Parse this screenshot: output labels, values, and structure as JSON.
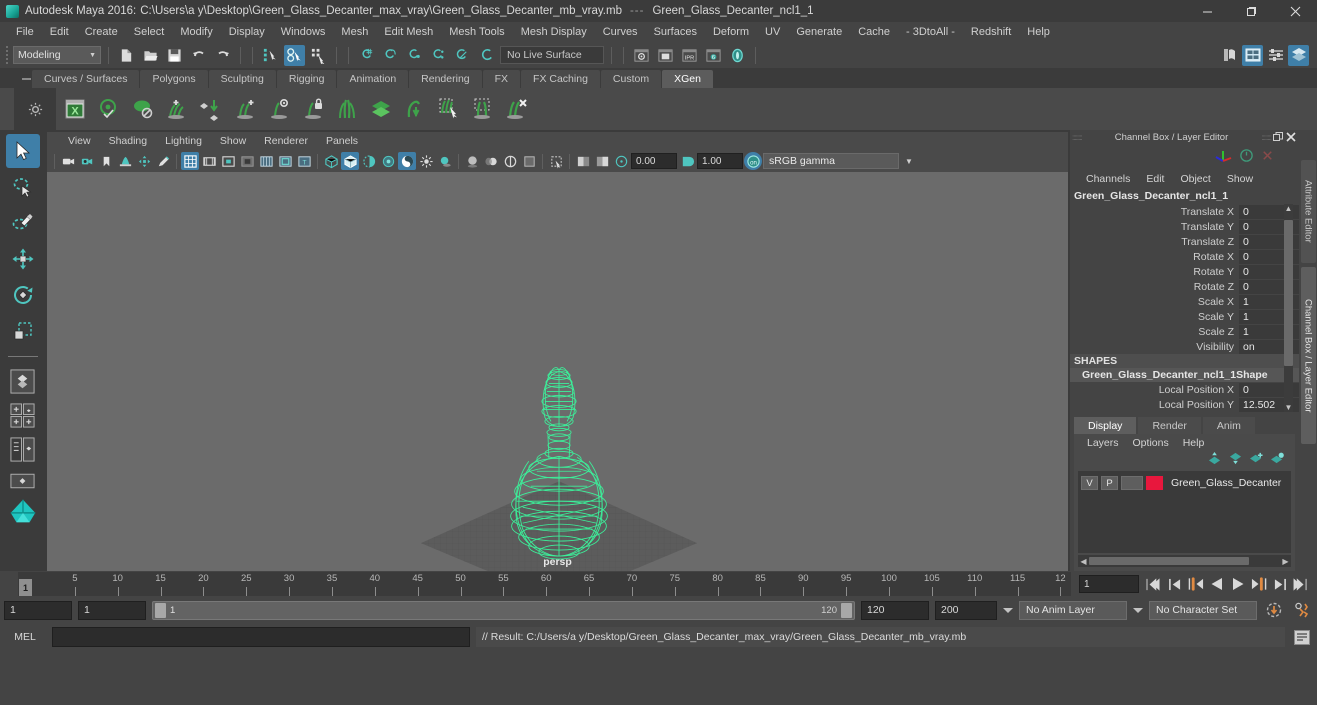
{
  "window": {
    "app_title": "Autodesk Maya 2016:",
    "file_path": "C:\\Users\\a y\\Desktop\\Green_Glass_Decanter_max_vray\\Green_Glass_Decanter_mb_vray.mb",
    "separator": "---",
    "selected_object": "Green_Glass_Decanter_ncl1_1",
    "minimize": "—",
    "maximize": "❐",
    "close": "✕"
  },
  "menubar": {
    "items": [
      "File",
      "Edit",
      "Create",
      "Select",
      "Modify",
      "Display",
      "Windows",
      "Mesh",
      "Edit Mesh",
      "Mesh Tools",
      "Mesh Display",
      "Curves",
      "Surfaces",
      "Deform",
      "UV",
      "Generate",
      "Cache",
      "- 3DtoAll -",
      "Redshift",
      "Help"
    ]
  },
  "statusbar": {
    "menuset": "Modeling",
    "live_surface": "No Live Surface",
    "icons": [
      "new-scene-icon",
      "open-scene-icon",
      "save-scene-icon",
      "undo-icon",
      "redo-icon",
      "select-by-hierarchy-icon",
      "select-by-object-icon",
      "select-by-component-icon",
      "snap-to-grid-icon",
      "snap-to-curve-icon",
      "snap-to-point-icon",
      "snap-to-projected-center-icon",
      "snap-to-view-plane-icon",
      "make-live-icon",
      "render-view-icon",
      "render-region-icon",
      "ipr-render-icon",
      "render-settings-icon",
      "hypershade-icon",
      "show-hide-sidebar-icon",
      "attribute-editor-toggle-icon",
      "tool-settings-toggle-icon",
      "channel-box-toggle-icon"
    ]
  },
  "shelf": {
    "tabs": [
      "Curves / Surfaces",
      "Polygons",
      "Sculpting",
      "Rigging",
      "Animation",
      "Rendering",
      "FX",
      "FX Caching",
      "Custom",
      "XGen"
    ],
    "active_tab": "XGen",
    "icons": [
      "xgen-editor-icon",
      "xgen-preview-icon",
      "xgen-disable-preview-icon",
      "xgen-add-guides-icon",
      "xgen-place-guide-icon",
      "xgen-add-density-icon",
      "xgen-region-mask-icon",
      "xgen-lock-icon",
      "xgen-part-icon",
      "xgen-layers-icon",
      "xgen-comb-icon",
      "xgen-select-guides-icon",
      "xgen-clump-icon",
      "xgen-delete-guides-icon"
    ]
  },
  "toolbox": {
    "tools": [
      "select-tool",
      "lasso-select-tool",
      "paint-select-tool",
      "move-tool",
      "rotate-tool",
      "scale-tool"
    ],
    "active_tool": "select-tool",
    "layouts": [
      "single-perspective-layout-icon",
      "four-view-layout-icon",
      "outliner-persp-layout-icon",
      "persp-graph-layout-icon",
      "hypershade-persp-layout-icon"
    ]
  },
  "viewport": {
    "menus": [
      "View",
      "Shading",
      "Lighting",
      "Show",
      "Renderer",
      "Panels"
    ],
    "camera_label": "persp",
    "exposure": "0.00",
    "gamma": "1.00",
    "color_profile": "sRGB gamma",
    "toolbar_icons": [
      "select-camera-icon",
      "camera-attributes-icon",
      "bookmark-icon",
      "image-plane-icon",
      "two-d-pan-zoom-icon",
      "grease-pencil-icon",
      "grid-toggle-icon",
      "film-gate-icon",
      "resolution-gate-icon",
      "gate-mask-icon",
      "field-chart-icon",
      "safe-action-icon",
      "safe-title-icon",
      "wireframe-icon",
      "smooth-shade-all-icon",
      "shaded-wireframe-icon",
      "use-default-material-icon",
      "textured-icon",
      "use-all-lights-icon",
      "shadows-icon",
      "screen-space-ao-icon",
      "motion-blur-icon",
      "multisample-icon",
      "depth-of-field-icon",
      "isolate-select-icon",
      "xray-icon",
      "xray-joints-icon",
      "xray-active-components-icon",
      "exposure-icon",
      "gamma-icon",
      "color-management-icon"
    ],
    "model": {
      "name": "Green_Glass_Decanter_ncl1_1",
      "wireframe_color": "#3cf09a",
      "background_color": "#6b6b6b"
    },
    "axis_gizmo": {
      "x": "x",
      "y": "y",
      "z": "z"
    }
  },
  "channel_box": {
    "panel_title": "Channel Box / Layer Editor",
    "menus": [
      "Channels",
      "Edit",
      "Object",
      "Show"
    ],
    "object_name": "Green_Glass_Decanter_ncl1_1",
    "transform_attrs": [
      {
        "label": "Translate X",
        "value": "0"
      },
      {
        "label": "Translate Y",
        "value": "0"
      },
      {
        "label": "Translate Z",
        "value": "0"
      },
      {
        "label": "Rotate X",
        "value": "0"
      },
      {
        "label": "Rotate Y",
        "value": "0"
      },
      {
        "label": "Rotate Z",
        "value": "0"
      },
      {
        "label": "Scale X",
        "value": "1"
      },
      {
        "label": "Scale Y",
        "value": "1"
      },
      {
        "label": "Scale Z",
        "value": "1"
      },
      {
        "label": "Visibility",
        "value": "on"
      }
    ],
    "shapes_header": "SHAPES",
    "shape_name": "Green_Glass_Decanter_ncl1_1Shape",
    "shape_attrs": [
      {
        "label": "Local Position X",
        "value": "0"
      },
      {
        "label": "Local Position Y",
        "value": "12.502"
      }
    ]
  },
  "layer_editor": {
    "tabs": [
      "Display",
      "Render",
      "Anim"
    ],
    "active_tab": "Display",
    "menus": [
      "Layers",
      "Options",
      "Help"
    ],
    "toolbar_icons": [
      "move-layer-up-icon",
      "move-layer-down-icon",
      "new-layer-icon",
      "new-layer-from-selected-icon"
    ],
    "layers": [
      {
        "visibility": "V",
        "playback": "P",
        "color": "#e8173d",
        "name": "Green_Glass_Decanter"
      }
    ]
  },
  "right_tabs": {
    "items": [
      "Attribute Editor",
      "Channel Box / Layer Editor"
    ],
    "active": "Channel Box / Layer Editor"
  },
  "timeline": {
    "tick_labels": [
      "5",
      "10",
      "15",
      "20",
      "25",
      "30",
      "35",
      "40",
      "45",
      "50",
      "55",
      "60",
      "65",
      "70",
      "75",
      "80",
      "85",
      "90",
      "95",
      "100",
      "105",
      "110",
      "115",
      "12"
    ],
    "current_frame": "1",
    "frame_field": "1",
    "playback_buttons": [
      "go-to-start-icon",
      "step-back-keyframe-icon",
      "step-back-frame-icon",
      "play-backwards-icon",
      "play-forwards-icon",
      "step-forward-frame-icon",
      "step-forward-keyframe-icon",
      "go-to-end-icon"
    ]
  },
  "range": {
    "anim_start": "1",
    "range_start": "1",
    "slider_min": "1",
    "slider_max": "120",
    "range_end": "120",
    "anim_end": "200",
    "anim_layer": "No Anim Layer",
    "character_set": "No Character Set",
    "auto_keyframe_icon": "auto-keyframe-icon",
    "animation_prefs_icon": "animation-preferences-icon"
  },
  "command_line": {
    "language": "MEL",
    "input_value": "",
    "result": "// Result: C:/Users/a y/Desktop/Green_Glass_Decanter_max_vray/Green_Glass_Decanter_mb_vray.mb",
    "script_editor_icon": "script-editor-icon"
  }
}
